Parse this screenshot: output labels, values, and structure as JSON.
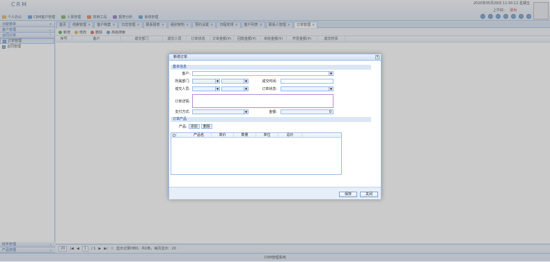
{
  "app": {
    "brand": "CRM",
    "datetime": "2020年05月29日 11:50:12 星期五",
    "user_label": "上午好:",
    "logout": "退出"
  },
  "menus": [
    {
      "label": "个人办公",
      "color": "#e8a030"
    },
    {
      "label": "CRM客户管理",
      "color": "#4a8ad0"
    },
    {
      "label": "人事管理",
      "color": "#5aa040"
    },
    {
      "label": "常用工具",
      "color": "#d07030"
    },
    {
      "label": "报表分析",
      "color": "#8060c0"
    },
    {
      "label": "系统管理",
      "color": "#4a90c0"
    }
  ],
  "sidebar": {
    "header": "功能菜单",
    "groups": [
      {
        "label": "客户管理"
      },
      {
        "label": "合同订单"
      }
    ],
    "items": [
      {
        "label": "订单管理"
      },
      {
        "label": "合同管理"
      }
    ],
    "bottom": [
      {
        "label": "财务管理"
      },
      {
        "label": "产品管理"
      }
    ]
  },
  "tabs": [
    "首页",
    "线索管理",
    "客户档案",
    "日志管理",
    "联系报表",
    "组织架构",
    "预约设置",
    "日程安排",
    "客户列表",
    "联系人管理",
    "订单管理"
  ],
  "toolbar": {
    "add": "新增",
    "edit": "修改",
    "delete": "删除",
    "search": "高级搜索"
  },
  "grid": {
    "columns": [
      "序号",
      "客户",
      "成交部门",
      "成交人员",
      "订单状态",
      "订单金额(¥)",
      "回款金额(¥)",
      "未收金额(¥)",
      "开票金额(¥)",
      "成交时间"
    ]
  },
  "pager": {
    "page_size": "20",
    "page": "1",
    "total_pages": "/ 1",
    "info": "显示记录0到0，共0条，每页显示：20"
  },
  "footer": "CRM管理系统",
  "dialog": {
    "title": "新增订单",
    "section_basic": "基本信息",
    "customer_label": "客户:",
    "dept_label": "所属部门:",
    "deal_time_label": "成交时间:",
    "deal_person_label": "成交人员:",
    "order_status_label": "订单状态:",
    "notes_label": "订单详情:",
    "payment_label": "支付方式:",
    "amount_label": "金额:",
    "amount_value": "0",
    "section_products": "订单产品",
    "product_label": "产品:",
    "add_btn": "添加",
    "delete_btn": "删除",
    "product_columns": [
      "产品名",
      "单价",
      "数量",
      "单位",
      "总价"
    ],
    "save": "保存",
    "close": "关闭"
  }
}
